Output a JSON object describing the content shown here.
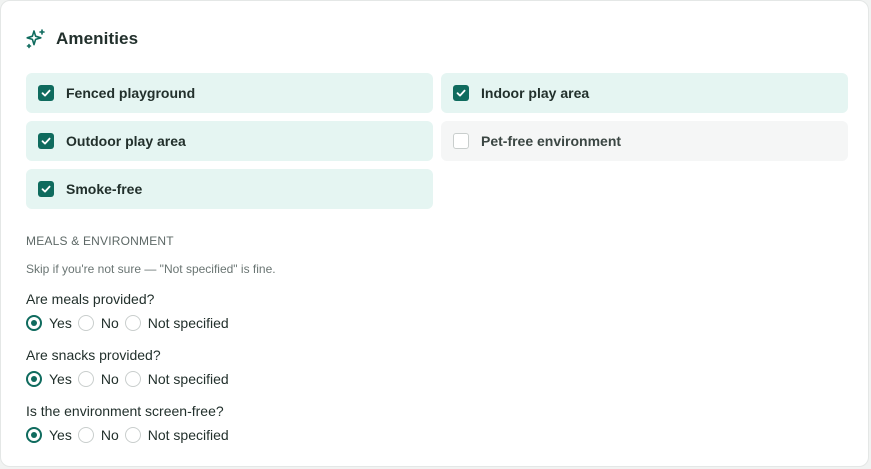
{
  "section": {
    "title": "Amenities",
    "icon": "sparkle-icon"
  },
  "amenities": [
    {
      "label": "Fenced playground",
      "checked": true
    },
    {
      "label": "Indoor play area",
      "checked": true
    },
    {
      "label": "Outdoor play area",
      "checked": true
    },
    {
      "label": "Pet-free environment",
      "checked": false
    },
    {
      "label": "Smoke-free",
      "checked": true
    }
  ],
  "meals": {
    "heading": "MEALS & ENVIRONMENT",
    "hint": "Skip if you're not sure — \"Not specified\" is fine.",
    "options": [
      "Yes",
      "No",
      "Not specified"
    ],
    "questions": [
      {
        "label": "Are meals provided?",
        "selected": "Yes"
      },
      {
        "label": "Are snacks provided?",
        "selected": "Yes"
      },
      {
        "label": "Is the environment screen-free?",
        "selected": "Yes"
      }
    ]
  },
  "colors": {
    "accent": "#0f6b5e",
    "checked_bg": "#e5f5f2",
    "unchecked_bg": "#f5f6f6"
  }
}
